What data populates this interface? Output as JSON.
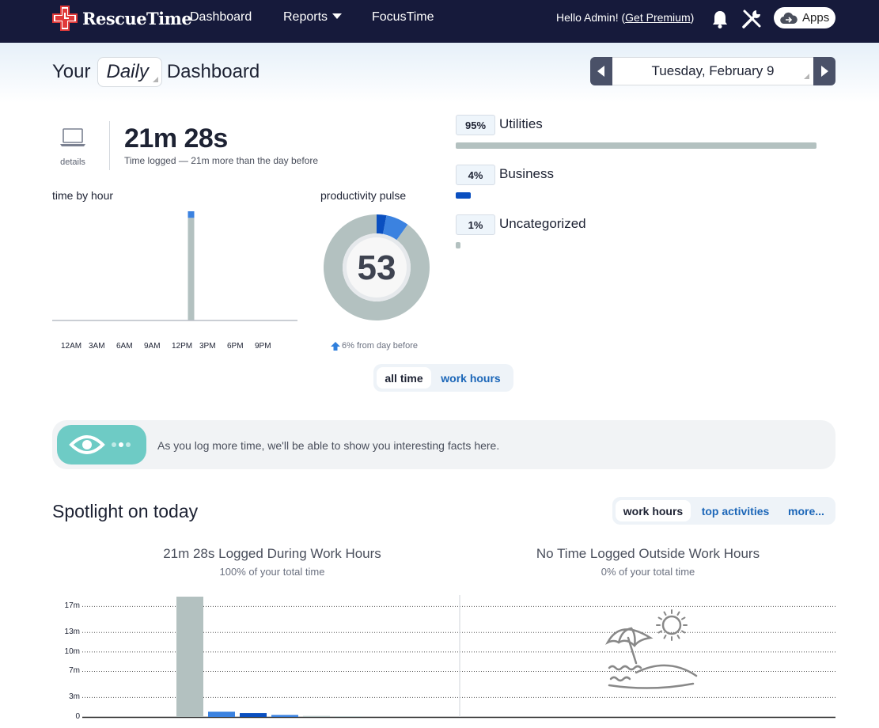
{
  "app": {
    "brand": "RescueTime"
  },
  "nav": {
    "links": [
      "Dashboard",
      "Reports",
      "FocusTime"
    ],
    "greeting": "Hello Admin! (",
    "premium_link": "Get Premium",
    "greeting_end": ")",
    "apps_label": "Apps"
  },
  "header": {
    "title_prefix": "Your",
    "period": "Daily",
    "title_suffix": "Dashboard",
    "date": "Tuesday, February 9"
  },
  "summary": {
    "details_label": "details",
    "total_time": "21m 28s",
    "total_sub": "Time logged — 21m more than the day before",
    "time_by_hour_label": "time by hour",
    "hour_ticks": [
      "12AM",
      "3AM",
      "6AM",
      "9AM",
      "12PM",
      "3PM",
      "6PM",
      "9PM"
    ],
    "hour_bar": {
      "hour": 13,
      "fraction_of_max": 1.0,
      "top_segment_fraction": 0.06
    },
    "pulse_label": "productivity pulse",
    "pulse_score": "53",
    "pulse_change": "6% from day before",
    "pulse_segments": [
      {
        "name": "very productive",
        "fraction": 0.03,
        "color": "#0a4fc0"
      },
      {
        "name": "productive",
        "fraction": 0.07,
        "color": "#3b82e0"
      },
      {
        "name": "neutral",
        "fraction": 0.9,
        "color": "#b3c1c0"
      }
    ]
  },
  "categories": [
    {
      "percent": "95%",
      "name": "Utilities",
      "fraction": 0.95,
      "color": "#b3c1c0"
    },
    {
      "percent": "4%",
      "name": "Business",
      "fraction": 0.04,
      "color": "#0a4fc0"
    },
    {
      "percent": "1%",
      "name": "Uncategorized",
      "fraction": 0.01,
      "color": "#b3c1c0"
    }
  ],
  "toggle": {
    "options": [
      "all time",
      "work hours"
    ],
    "active": "all time"
  },
  "facts": {
    "message": "As you log more time, we'll be able to show you interesting facts here."
  },
  "spotlight": {
    "title": "Spotlight on today",
    "tabs": [
      "work hours",
      "top activities",
      "more..."
    ],
    "active_tab": "work hours",
    "work_heading": "21m 28s Logged During Work Hours",
    "work_sub": "100% of your total time",
    "outside_heading": "No Time Logged Outside Work Hours",
    "outside_sub": "0% of your total time"
  },
  "chart_data": {
    "type": "bar",
    "title": "",
    "xlabel": "",
    "ylabel": "",
    "yticks": [
      "17m",
      "13m",
      "10m",
      "7m",
      "3m",
      "0"
    ],
    "ytick_values": [
      17,
      13,
      10,
      7,
      3,
      0
    ],
    "ylim": [
      0,
      18.5
    ],
    "grid": true,
    "series": [
      {
        "values": [
          18.5,
          0.8,
          0.6,
          0.3,
          0.15,
          0.1
        ],
        "colors": [
          "#b3c1c0",
          "#3b82e0",
          "#0a4fc0",
          "#3b82e0",
          "#b3c1c0",
          "#b3c1c0"
        ]
      }
    ]
  }
}
